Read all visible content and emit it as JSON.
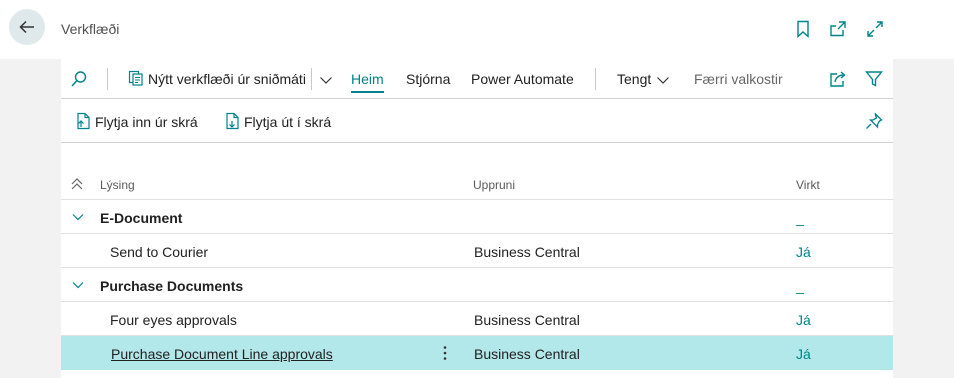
{
  "page": {
    "title": "Verkflæði"
  },
  "actions": {
    "new_from_template": "Nýtt verkflæði úr sniðmáti",
    "tab_home": "Heim",
    "tab_manage": "Stjórna",
    "tab_power_automate": "Power Automate",
    "related": "Tengt",
    "fewer_options": "Færri valkostir",
    "import_from_file": "Flytja inn úr skrá",
    "export_to_file": "Flytja út í skrá"
  },
  "table": {
    "columns": {
      "description": "Lýsing",
      "source": "Uppruni",
      "enabled": "Virkt"
    },
    "rows": [
      {
        "type": "group",
        "description": "E-Document",
        "source": "",
        "enabled": "_"
      },
      {
        "type": "item",
        "description": "Send to Courier",
        "source": "Business Central",
        "enabled": "Já"
      },
      {
        "type": "group",
        "description": "Purchase Documents",
        "source": "",
        "enabled": "_"
      },
      {
        "type": "item",
        "description": "Four eyes approvals",
        "source": "Business Central",
        "enabled": "Já"
      },
      {
        "type": "item",
        "description": "Purchase Document Line approvals",
        "source": "Business Central",
        "enabled": "Já",
        "selected": true
      }
    ]
  },
  "colors": {
    "accent": "#00838a",
    "selected_row": "#b3e8ea",
    "back_button_bg": "#dfe9eb"
  },
  "icons": [
    "back-arrow-icon",
    "bookmark-icon",
    "open-new-window-icon",
    "expand-icon",
    "search-icon",
    "template-icon",
    "chevron-down-icon",
    "share-icon",
    "filter-icon",
    "file-import-icon",
    "file-export-icon",
    "pin-icon",
    "collapse-all-icon",
    "more-options-icon"
  ]
}
